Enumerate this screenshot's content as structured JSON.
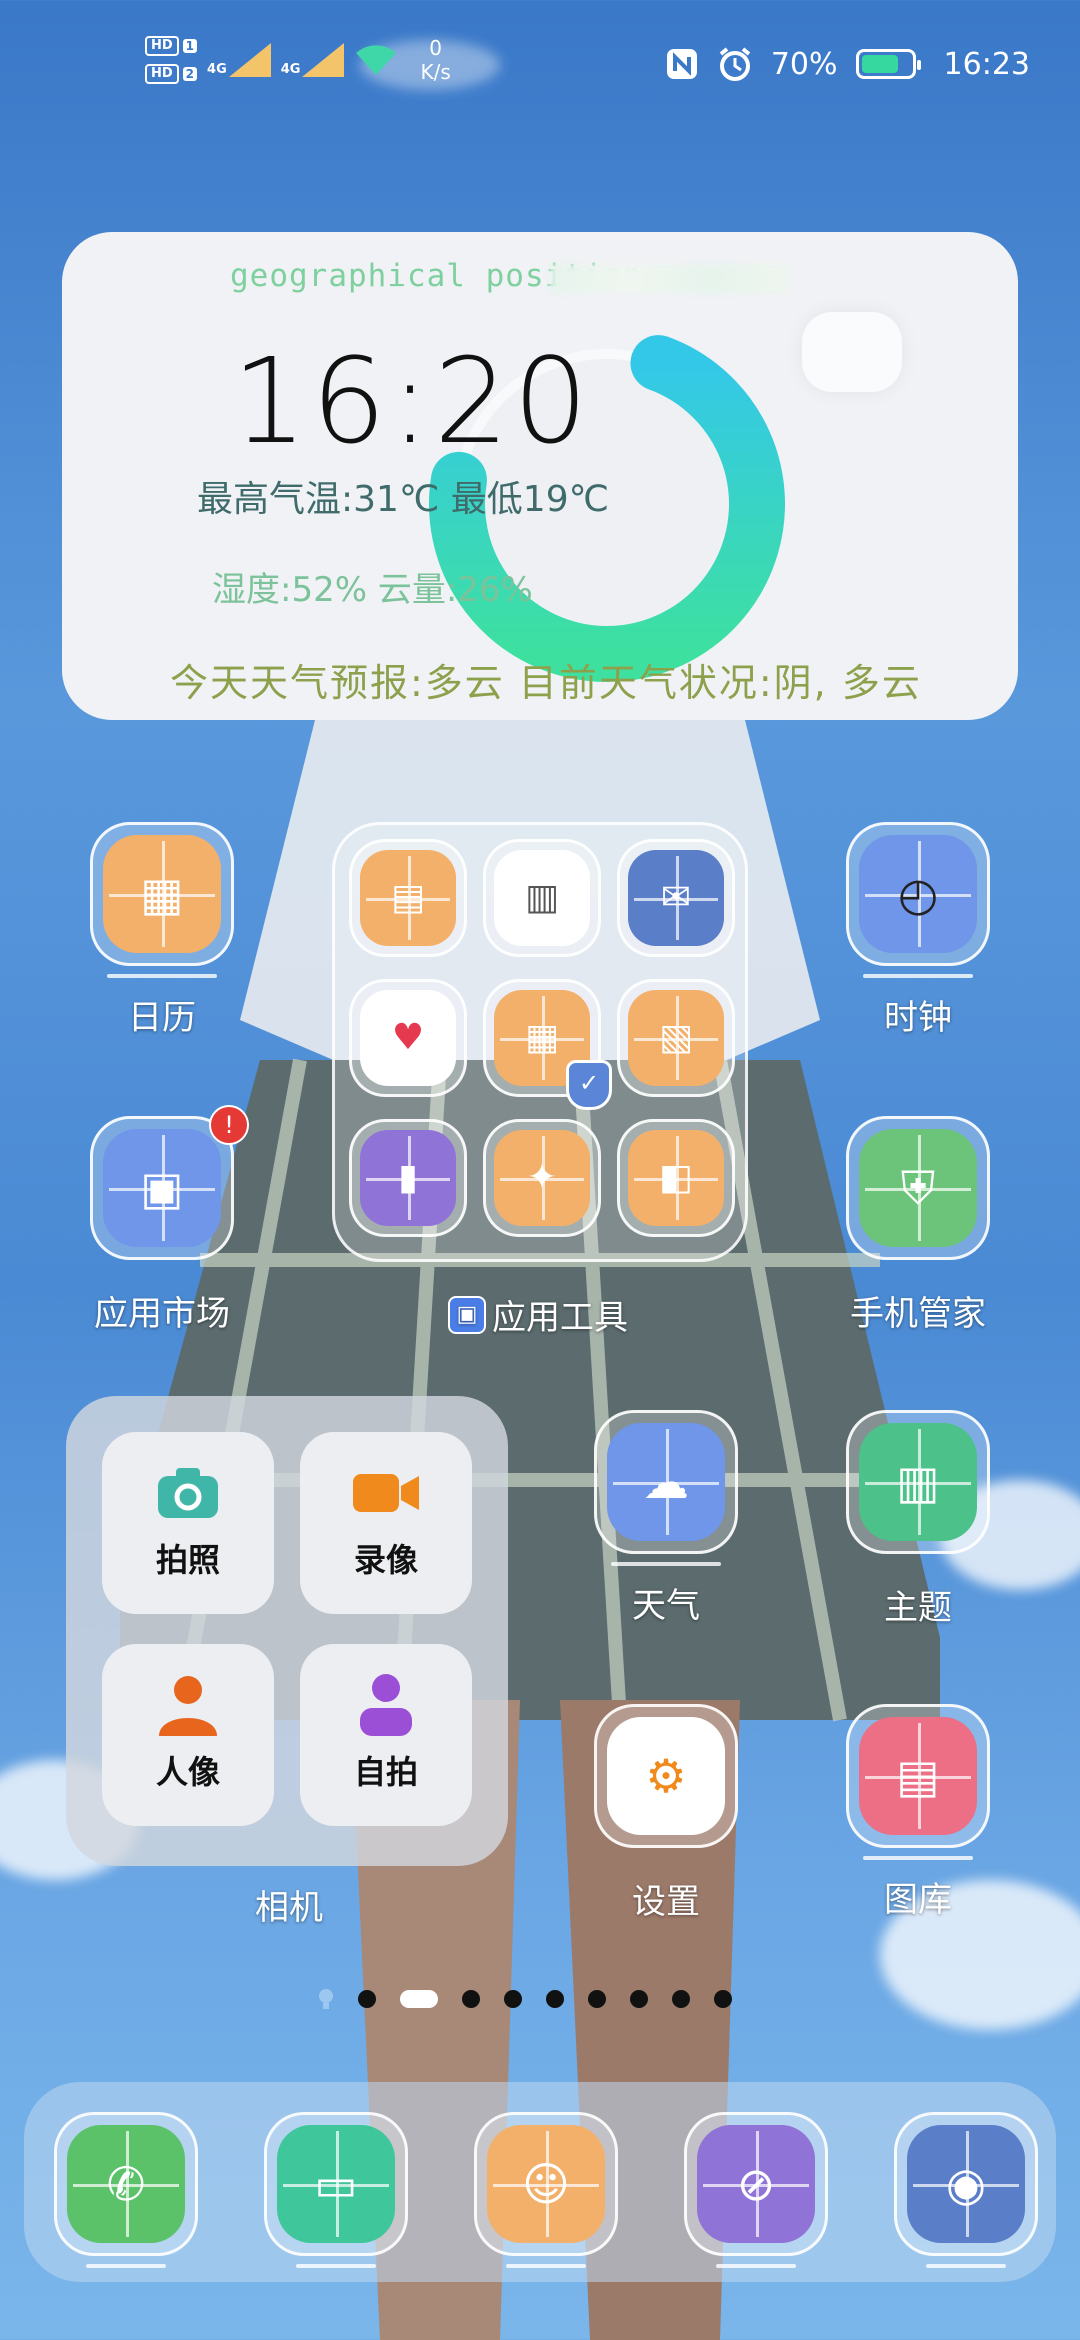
{
  "status_bar": {
    "hd1": "HD",
    "hd1_num": "1",
    "hd2": "HD",
    "hd2_num": "2",
    "sig1": "4G",
    "sig2": "4G",
    "speed_value": "0",
    "speed_unit": "K/s",
    "battery_percent": "70%",
    "time": "16:23",
    "battery_level": 0.7,
    "icons": [
      "nfc-icon",
      "alarm-icon",
      "wifi-icon"
    ]
  },
  "weather_widget": {
    "geo_label": "geographical position",
    "time": "16:20",
    "temp_line": "最高气温:31℃  最低19℃",
    "humidity_line": "湿度:52%   云量:26%",
    "forecast_line": "今天天气预报:多云    目前天气状况:阴, 多云",
    "cloud_fraction": 0.26
  },
  "apps": {
    "calendar": {
      "label": "日历",
      "color": "#f2b06b",
      "icon": "calendar-icon"
    },
    "clock": {
      "label": "时钟",
      "color": "#6f96e8",
      "icon": "clock-icon"
    },
    "appmarket": {
      "label": "应用市场",
      "color": "#6f96e8",
      "icon": "shopping-bag-icon",
      "badge": "!"
    },
    "phonemanager": {
      "label": "手机管家",
      "color": "#6cc47a",
      "icon": "shield-icon"
    },
    "weather": {
      "label": "天气",
      "color": "#6f96e8",
      "icon": "weather-icon"
    },
    "themes": {
      "label": "主题",
      "color": "#4cc28a",
      "icon": "theme-icon"
    },
    "settings": {
      "label": "设置",
      "color": "#ffffff",
      "icon": "settings-icon"
    },
    "gallery": {
      "label": "图库",
      "color": "#ec6f86",
      "icon": "gallery-icon"
    }
  },
  "folder": {
    "label": "应用工具",
    "items": [
      {
        "icon": "file-manager-icon",
        "color": "#f2b06b"
      },
      {
        "icon": "notepad-icon",
        "color": "#ffffff"
      },
      {
        "icon": "email-icon",
        "color": "#5a7ec8"
      },
      {
        "icon": "health-icon",
        "color": "#ffffff"
      },
      {
        "icon": "toolbox-icon",
        "color": "#f2b06b"
      },
      {
        "icon": "document-icon",
        "color": "#f2b06b"
      },
      {
        "icon": "phone-clone-icon",
        "color": "#8f73d6"
      },
      {
        "icon": "compass-icon",
        "color": "#f2b06b"
      },
      {
        "icon": "scanner-icon",
        "color": "#f2b06b"
      }
    ]
  },
  "camera_widget": {
    "label": "相机",
    "buttons": [
      {
        "label": "拍照",
        "icon": "camera-icon",
        "color": "#3fb6a8"
      },
      {
        "label": "录像",
        "icon": "video-icon",
        "color": "#f08a1c"
      },
      {
        "label": "人像",
        "icon": "portrait-icon",
        "color": "#e8651e"
      },
      {
        "label": "自拍",
        "icon": "selfie-icon",
        "color": "#9b4fd6"
      }
    ]
  },
  "page_indicator": {
    "total": 10,
    "active": 1
  },
  "dock": [
    {
      "icon": "phone-icon",
      "color": "#5cc26a"
    },
    {
      "icon": "messages-icon",
      "color": "#3fc69a"
    },
    {
      "icon": "contacts-icon",
      "color": "#f2b06b"
    },
    {
      "icon": "browser-icon",
      "color": "#8f73d6"
    },
    {
      "icon": "camera-icon",
      "color": "#5a7ec8"
    }
  ]
}
